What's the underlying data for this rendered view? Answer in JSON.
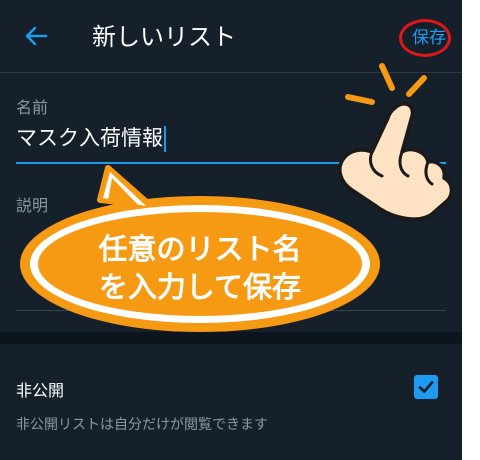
{
  "header": {
    "title": "新しいリスト",
    "save_label": "保存",
    "back_icon": "back-arrow-icon"
  },
  "form": {
    "name_label": "名前",
    "name_value": "マスク入荷情報",
    "description_label": "説明",
    "description_value": "",
    "private_label": "非公開",
    "private_checked": true,
    "private_note": "非公開リストは自分だけが閲覧できます"
  },
  "annotation": {
    "bubble_line1": "任意のリスト名",
    "bubble_line2": "を入力して保存"
  },
  "colors": {
    "background": "#15202b",
    "accent": "#1d9bf0",
    "highlight_circle": "#e01818",
    "bubble_fill": "#f59a12"
  }
}
